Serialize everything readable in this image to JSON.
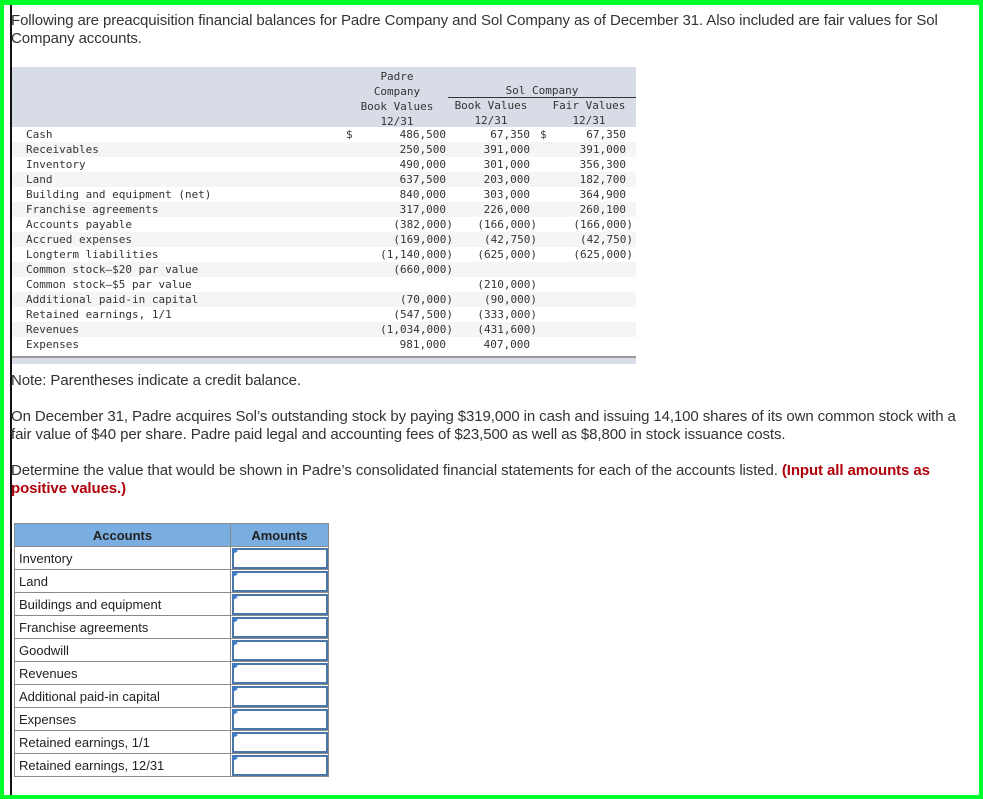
{
  "intro": "Following are preacquisition financial balances for Padre Company and Sol Company as of December 31. Also included are fair values for Sol Company accounts.",
  "balances": {
    "headers": {
      "padre": [
        "Padre",
        "Company",
        "Book Values",
        "12/31"
      ],
      "sol_group": "Sol Company",
      "sol_book": [
        "Book Values",
        "12/31"
      ],
      "sol_fair": [
        "Fair Values",
        "12/31"
      ]
    },
    "currency_symbol": "$",
    "rows": [
      {
        "account": "Cash",
        "padre_bv": "486,500",
        "sol_bv": "67,350",
        "sol_fv": "67,350",
        "dollar": true
      },
      {
        "account": "Receivables",
        "padre_bv": "250,500",
        "sol_bv": "391,000",
        "sol_fv": "391,000"
      },
      {
        "account": "Inventory",
        "padre_bv": "490,000",
        "sol_bv": "301,000",
        "sol_fv": "356,300"
      },
      {
        "account": "Land",
        "padre_bv": "637,500",
        "sol_bv": "203,000",
        "sol_fv": "182,700"
      },
      {
        "account": "Building and equipment (net)",
        "padre_bv": "840,000",
        "sol_bv": "303,000",
        "sol_fv": "364,900"
      },
      {
        "account": "Franchise agreements",
        "padre_bv": "317,000",
        "sol_bv": "226,000",
        "sol_fv": "260,100"
      },
      {
        "account": "Accounts payable",
        "padre_bv": "(382,000)",
        "sol_bv": "(166,000)",
        "sol_fv": "(166,000)"
      },
      {
        "account": "Accrued expenses",
        "padre_bv": "(169,000)",
        "sol_bv": "(42,750)",
        "sol_fv": "(42,750)"
      },
      {
        "account": "Longterm liabilities",
        "padre_bv": "(1,140,000)",
        "sol_bv": "(625,000)",
        "sol_fv": "(625,000)"
      },
      {
        "account": "Common stock—$20 par value",
        "padre_bv": "(660,000)",
        "sol_bv": "",
        "sol_fv": ""
      },
      {
        "account": "Common stock—$5 par value",
        "padre_bv": "",
        "sol_bv": "(210,000)",
        "sol_fv": ""
      },
      {
        "account": "Additional paid-in capital",
        "padre_bv": "(70,000)",
        "sol_bv": "(90,000)",
        "sol_fv": ""
      },
      {
        "account": "Retained earnings, 1/1",
        "padre_bv": "(547,500)",
        "sol_bv": "(333,000)",
        "sol_fv": ""
      },
      {
        "account": "Revenues",
        "padre_bv": "(1,034,000)",
        "sol_bv": "(431,600)",
        "sol_fv": ""
      },
      {
        "account": "Expenses",
        "padre_bv": "981,000",
        "sol_bv": "407,000",
        "sol_fv": ""
      }
    ]
  },
  "note": "Note: Parentheses indicate a credit balance.",
  "scenario": "On December 31, Padre acquires Sol’s outstanding stock by paying $319,000 in cash and issuing 14,100 shares of its own common stock with a fair value of $40 per share. Padre paid legal and accounting fees of $23,500 as well as $8,800 in stock issuance costs.",
  "instruction": "Determine the value that would be shown in Padre’s consolidated financial statements for each of the accounts listed.",
  "instruction_emphasis": "(Input all amounts as positive values.)",
  "answer_table": {
    "headers": {
      "accounts": "Accounts",
      "amounts": "Amounts"
    },
    "rows": [
      {
        "account": "Inventory",
        "value": ""
      },
      {
        "account": "Land",
        "value": ""
      },
      {
        "account": "Buildings and equipment",
        "value": ""
      },
      {
        "account": "Franchise agreements",
        "value": ""
      },
      {
        "account": "Goodwill",
        "value": ""
      },
      {
        "account": "Revenues",
        "value": ""
      },
      {
        "account": "Additional paid-in capital",
        "value": ""
      },
      {
        "account": "Expenses",
        "value": ""
      },
      {
        "account": "Retained earnings, 1/1",
        "value": ""
      },
      {
        "account": "Retained earnings, 12/31",
        "value": ""
      }
    ]
  }
}
